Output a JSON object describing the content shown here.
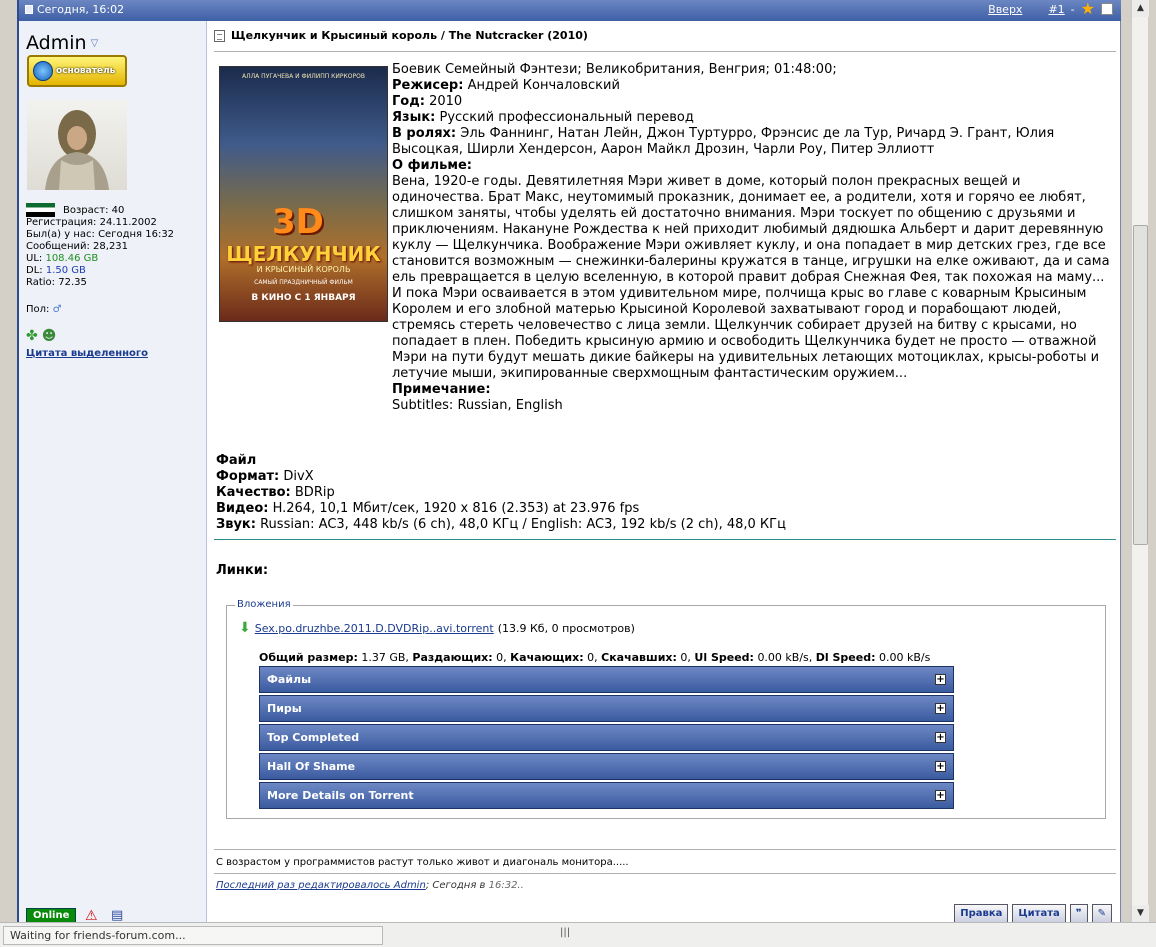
{
  "topbar": {
    "date": "Сегодня, 16:02",
    "up_link": "Вверх",
    "post_number": "#1",
    "dash": "-"
  },
  "user": {
    "name": "Admin",
    "rank_label": "основатель",
    "flag": "flag-icon",
    "age": "Возраст: 40",
    "registered": "Регистрация: 24.11.2002",
    "last_seen": "Был(а) у нас: Сегодня 16:32",
    "posts": "Сообщений: 28,231",
    "ul_label": "UL:",
    "ul_value": "108.46 GB",
    "dl_label": "DL:",
    "dl_value": "1.50 GB",
    "ratio": "Ratio: 72.35",
    "gender_label": "Пол:",
    "gender_symbol": "♂",
    "quote_selected": "Цитата выделенного",
    "online": "Online"
  },
  "post": {
    "title": "Щелкунчик и Крысиный король / The Nutcracker (2010)",
    "poster": {
      "top": "АЛЛА ПУГАЧЕВА И ФИЛИПП КИРКОРОВ",
      "big3d": "3D",
      "title": "ЩЕЛКУНЧИК",
      "subtitle": "И КРЫСИНЫЙ КОРОЛЬ",
      "tag": "САМЫЙ ПРАЗДНИЧНЫЙ ФИЛЬМ",
      "release": "В КИНО С 1 ЯНВАРЯ"
    },
    "genre": "Боевик Семейный Фэнтези; Великобритания, Венгрия; 01:48:00;",
    "director_label": "Режисер:",
    "director": "Андрей Кончаловский",
    "year_label": "Год:",
    "year": "2010",
    "lang_label": "Язык:",
    "lang": "Русский профессиональный перевод",
    "cast_label": "В ролях:",
    "cast": "Эль Фаннинг, Натан Лейн, Джон Туртурро, Фрэнсис де ла Тур, Ричард Э. Грант, Юлия Высоцкая, Ширли Хендерсон, Аарон Майкл Дрозин, Чарли Роу, Питер Эллиотт",
    "about_label": "О фильме:",
    "about": "Вена, 1920-е годы. Девятилетняя Мэри живет в доме, который полон прекрасных вещей и одиночества. Брат Макс, неутомимый проказник, донимает ее, а родители, хотя и горячо ее любят, слишком заняты, чтобы уделять ей достаточно внимания. Мэри тоскует по общению с друзьями и приключениям. Накануне Рождества к ней приходит любимый дядюшка Альберт и дарит деревянную куклу — Щелкунчика. Воображение Мэри оживляет куклу, и она попадает в мир детских грез, где все становится возможным — снежинки-балерины кружатся в танце, игрушки на елке оживают, да и сама ель превращается в целую вселенную, в которой правит добрая Снежная Фея, так похожая на маму... И пока Мэри осваивается в этом удивительном мире, полчища крыс во главе с коварным Крысиным Королем и его злобной матерью Крысиной Королевой захватывают город и порабощают людей, стремясь стереть человечество с лица земли. Щелкунчик собирает друзей на битву с крысами, но попадает в плен. Победить крысиную армию и освободить Щелкунчика будет не просто — отважной Мэри на пути будут мешать дикие байкеры на удивительных летающих мотоциклах, крысы-роботы и летучие мыши, экипированные сверхмощным фантастическим оружием...",
    "note_label": "Примечание:",
    "note": "Subtitles: Russian, English",
    "file_label": "Файл",
    "format_label": "Формат:",
    "format": "DivX",
    "quality_label": "Качество:",
    "quality": "BDRip",
    "video_label": "Видео:",
    "video": "H.264, 10,1 Мбит/сек, 1920 x 816 (2.353) at 23.976 fps",
    "audio_label": "Звук:",
    "audio": "Russian: AC3, 448 kb/s (6 ch), 48,0 КГц / English: AC3, 192 kb/s (2 ch), 48,0 КГц",
    "links_label": "Линки:"
  },
  "attachments": {
    "legend": "Вложения",
    "file_name": "Sex.po.druzhbe.2011.D.DVDRip..avi.torrent",
    "file_meta": "(13.9 Кб, 0 просмотров)",
    "stats": {
      "size_label": "Общий размер:",
      "size": "1.37 GB,",
      "seeders_label": "Раздающих:",
      "seeders": "0,",
      "leechers_label": "Качающих:",
      "leechers": "0,",
      "downloaded_label": "Скачавших:",
      "downloaded": "0,",
      "ul_label": "Ul Speed:",
      "ul": "0.00 kB/s,",
      "dl_label": "Dl Speed:",
      "dl": "0.00 kB/s"
    },
    "sections": [
      "Файлы",
      "Пиры",
      "Top Completed",
      "Hall Of Shame",
      "More Details on Torrent"
    ]
  },
  "signature": "С возрастом у программистов растут только живот и диагональ монитора.....",
  "edited": {
    "text": "Последний раз редактировалось Admin",
    "sep": ";",
    "when": "Сегодня в",
    "time": "16:32.."
  },
  "buttons": {
    "edit": "Правка",
    "quote": "Цитата",
    "multiquote": "❞"
  },
  "status_bar": "Waiting for friends-forum.com..."
}
